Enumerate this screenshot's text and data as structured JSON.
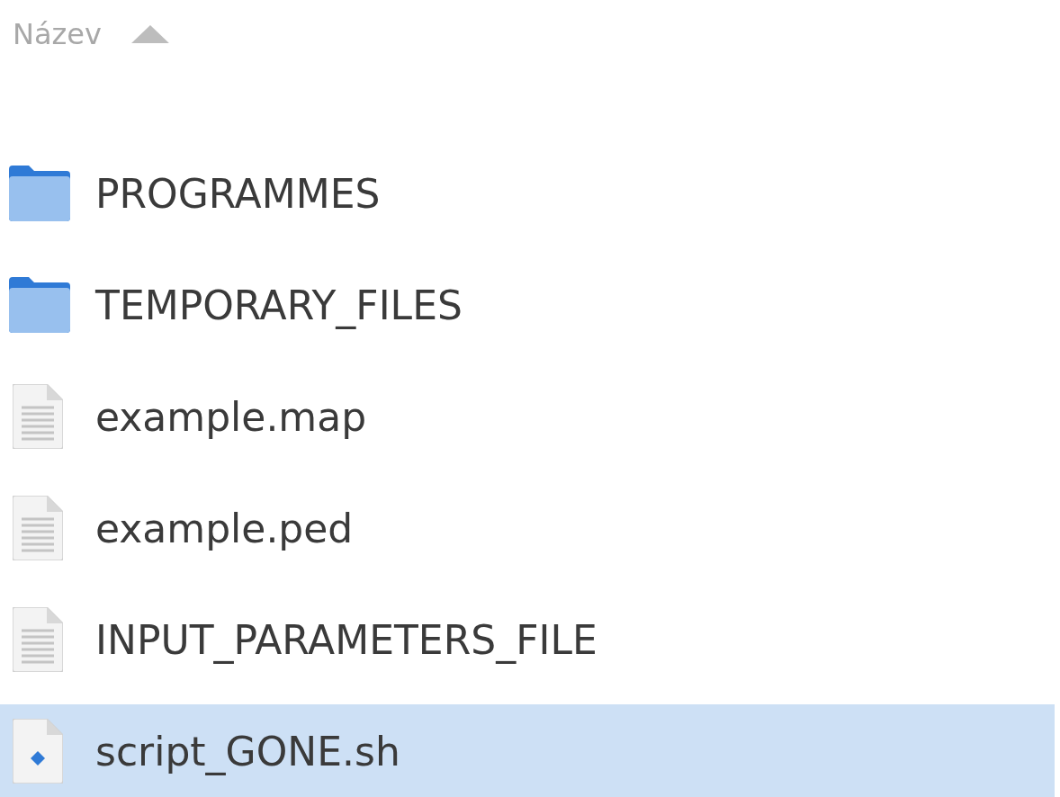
{
  "header": {
    "label": "Název",
    "sorted": true,
    "ascending": true
  },
  "files": [
    {
      "name": "PROGRAMMES",
      "kind": "folder",
      "selected": false
    },
    {
      "name": "TEMPORARY_FILES",
      "kind": "folder",
      "selected": false
    },
    {
      "name": "example.map",
      "kind": "text",
      "selected": false
    },
    {
      "name": "example.ped",
      "kind": "text",
      "selected": false
    },
    {
      "name": "INPUT_PARAMETERS_FILE",
      "kind": "text",
      "selected": false
    },
    {
      "name": "script_GONE.sh",
      "kind": "script",
      "selected": true
    }
  ]
}
